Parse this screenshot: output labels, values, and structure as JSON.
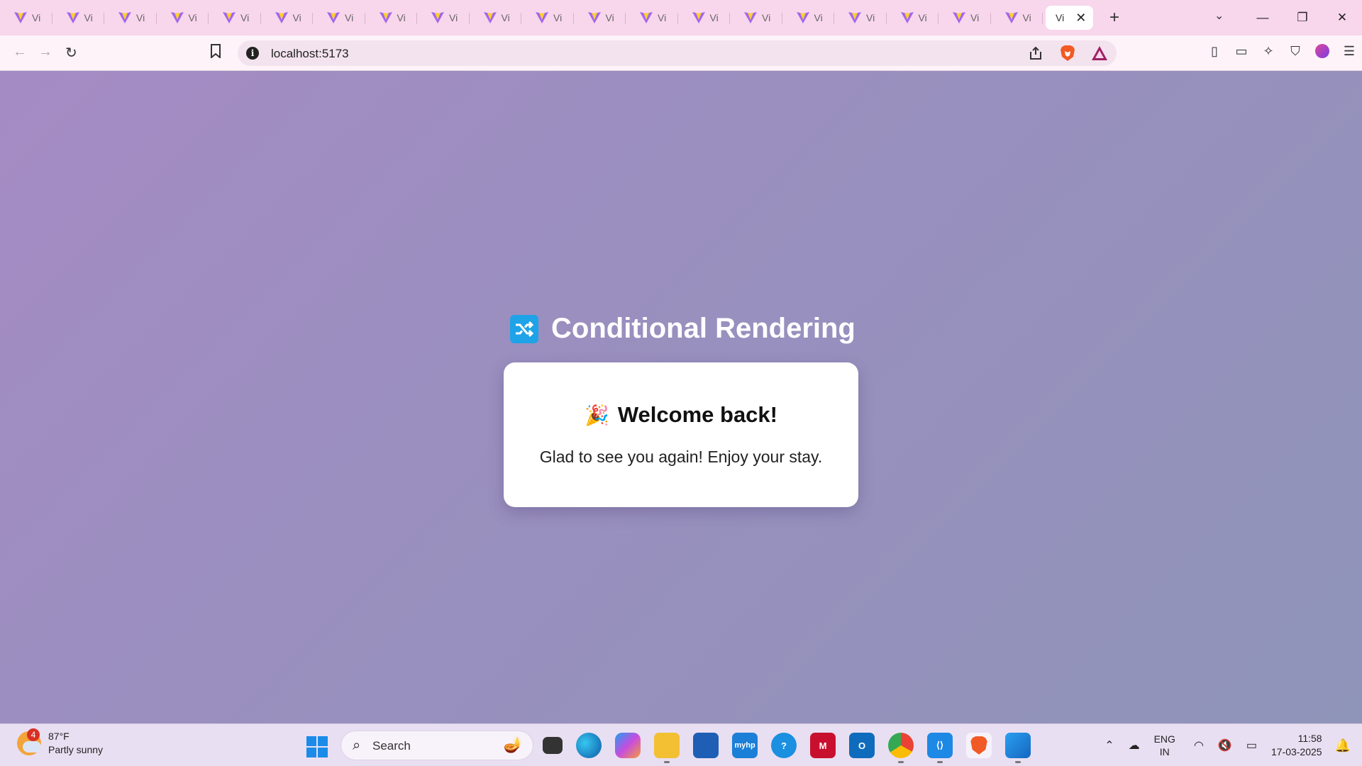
{
  "browser": {
    "tab_label": "Vi",
    "tab_count": 21,
    "active_tab_label": "Vi",
    "new_tab_symbol": "+",
    "tab_search_symbol": "⌄",
    "window_controls": {
      "minimize": "—",
      "maximize": "❐",
      "close": "✕"
    },
    "close_tab_symbol": "✕",
    "nav": {
      "back": "←",
      "forward": "→",
      "reload": "↻"
    },
    "bookmark_symbol": "🔖",
    "url": "localhost:5173"
  },
  "page": {
    "title": "Conditional Rendering",
    "card": {
      "heading": "Welcome back!",
      "emoji": "🎉",
      "message": "Glad to see you again! Enjoy your stay."
    }
  },
  "taskbar": {
    "weather": {
      "temp": "87°F",
      "condition": "Partly sunny",
      "badge": "4"
    },
    "search_placeholder": "Search",
    "language": {
      "line1": "ENG",
      "line2": "IN"
    },
    "clock": {
      "time": "11:58",
      "date": "17-03-2025"
    }
  },
  "colors": {
    "tabstrip": "#f8d6ec",
    "page_gradient_start": "#a58bc4",
    "page_gradient_end": "#8f94b9",
    "accent_icon": "#1ea3e8"
  }
}
